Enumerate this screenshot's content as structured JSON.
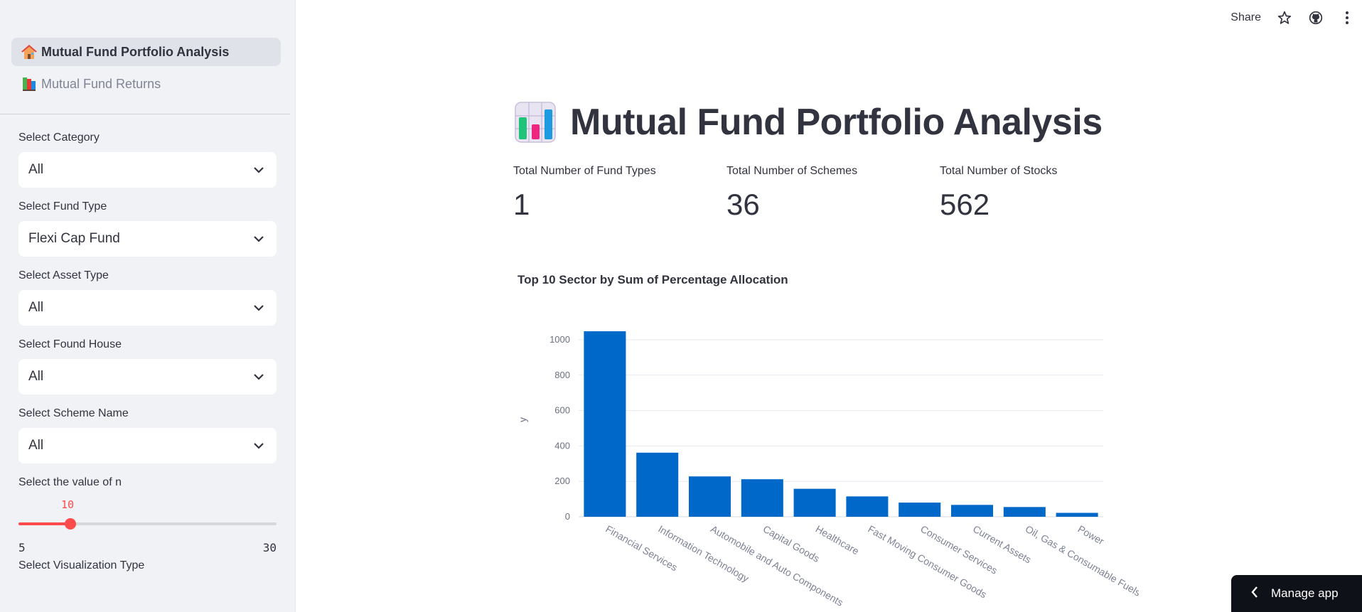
{
  "sidebar": {
    "nav": [
      {
        "label": "Mutual Fund Portfolio Analysis",
        "icon": "house-icon"
      },
      {
        "label": "Mutual Fund Returns",
        "icon": "books-icon"
      }
    ],
    "filters": [
      {
        "label": "Select Category",
        "value": "All"
      },
      {
        "label": "Select Fund Type",
        "value": "Flexi Cap Fund"
      },
      {
        "label": "Select Asset Type",
        "value": "All"
      },
      {
        "label": "Select Found House",
        "value": "All"
      },
      {
        "label": "Select Scheme Name",
        "value": "All"
      }
    ],
    "slider": {
      "label": "Select the value of n",
      "value": "10",
      "min": "5",
      "max": "30",
      "fraction": 0.2
    },
    "viz_label": "Select Visualization Type"
  },
  "toolbar": {
    "share_label": "Share"
  },
  "main": {
    "title": "Mutual Fund Portfolio Analysis",
    "metrics": [
      {
        "label": "Total Number of Fund Types",
        "value": "1"
      },
      {
        "label": "Total Number of Schemes",
        "value": "36"
      },
      {
        "label": "Total Number of Stocks",
        "value": "562"
      }
    ],
    "chart_title": "Top 10 Sector by Sum of Percentage Allocation"
  },
  "chart_data": {
    "type": "bar",
    "title": "Top 10 Sector by Sum of Percentage Allocation",
    "xlabel": "",
    "ylabel": "y",
    "categories": [
      "Financial Services",
      "Information Technology",
      "Automobile and Auto Components",
      "Capital Goods",
      "Healthcare",
      "Fast Moving Consumer Goods",
      "Consumer Services",
      "Current Assets",
      "Oil, Gas & Consumable Fuels",
      "Power"
    ],
    "values": [
      1048,
      362,
      228,
      212,
      158,
      115,
      80,
      67,
      55,
      22
    ],
    "yticks": [
      "0",
      "200",
      "400",
      "600",
      "800",
      "1000"
    ],
    "ylim": [
      0,
      1050
    ],
    "grid": true,
    "color": "#0068c9"
  },
  "manage_app_label": "Manage app",
  "colors": {
    "accent": "#ff4b4b",
    "bar": "#0068c9",
    "sidebar_bg": "#f0f2f6"
  }
}
